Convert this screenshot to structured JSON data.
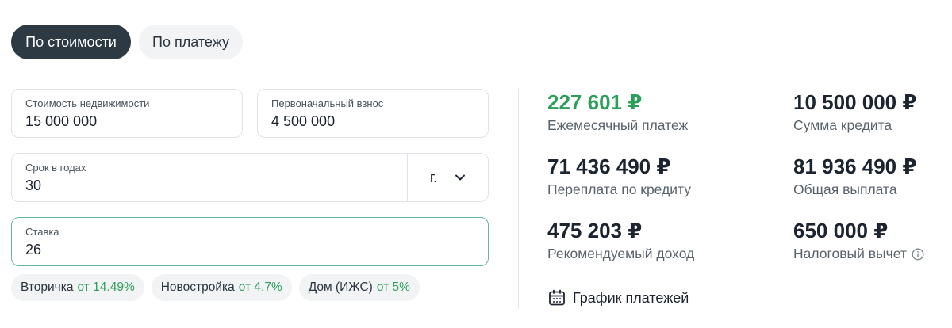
{
  "tabs": [
    {
      "label": "По стоимости",
      "active": true
    },
    {
      "label": "По платежу",
      "active": false
    }
  ],
  "fields": {
    "property_cost": {
      "label": "Стоимость недвижимости",
      "value": "15 000 000"
    },
    "down_payment": {
      "label": "Первоначальный взнос",
      "value": "4 500 000"
    },
    "term": {
      "label": "Срок в годах",
      "value": "30",
      "unit": "г."
    },
    "rate": {
      "label": "Ставка",
      "value": "26"
    }
  },
  "chips": [
    {
      "label": "Вторичка",
      "rate": "от 14.49%"
    },
    {
      "label": "Новостройка",
      "rate": "от 4.7%"
    },
    {
      "label": "Дом (ИЖС)",
      "rate": "от 5%"
    }
  ],
  "results": {
    "monthly_payment": {
      "value": "227 601 ₽",
      "label": "Ежемесячный платеж"
    },
    "loan_amount": {
      "value": "10 500 000 ₽",
      "label": "Сумма кредита"
    },
    "overpayment": {
      "value": "71 436 490 ₽",
      "label": "Переплата по кредиту"
    },
    "total_payment": {
      "value": "81 936 490 ₽",
      "label": "Общая выплата"
    },
    "recommended_income": {
      "value": "475 203 ₽",
      "label": "Рекомендуемый доход"
    },
    "tax_deduction": {
      "value": "650 000 ₽",
      "label": "Налоговый вычет"
    }
  },
  "schedule_link": "График платежей",
  "colors": {
    "accent_green": "#2e9e5b",
    "active_tab": "#2d3a44",
    "focus_border": "#5fb6a6"
  },
  "icons": {
    "unit_dropdown": "chevron-down-icon",
    "tax_info": "info-icon",
    "schedule": "calendar-icon"
  }
}
